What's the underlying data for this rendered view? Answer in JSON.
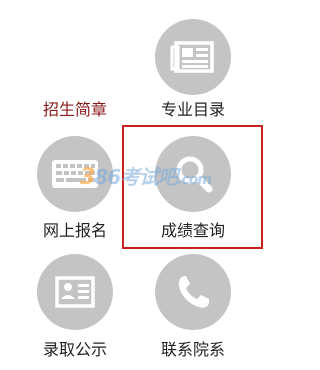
{
  "menu": {
    "tiles": [
      {
        "id": "zhaosheng",
        "label": "招生简章",
        "icon": "none",
        "color": "#8a1a1a"
      },
      {
        "id": "major-list",
        "label": "专业目录",
        "icon": "newspaper-icon"
      },
      {
        "id": "register",
        "label": "网上报名",
        "icon": "keyboard-icon"
      },
      {
        "id": "score",
        "label": "成绩查询",
        "icon": "magnifier-icon",
        "highlighted": true
      },
      {
        "id": "admission",
        "label": "录取公示",
        "icon": "id-card-icon"
      },
      {
        "id": "contact",
        "label": "联系院系",
        "icon": "phone-icon"
      }
    ]
  },
  "watermark": {
    "num": "3",
    "mid": "86",
    "brand": "考试吧",
    "sub": ".com"
  },
  "colors": {
    "circle": "#c4c4c4",
    "highlight_border": "#cc1f1f",
    "watermark_blue": "#78aadc",
    "watermark_orange": "#faaa46"
  }
}
